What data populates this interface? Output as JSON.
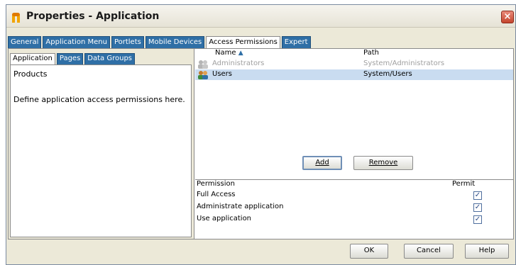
{
  "window": {
    "title": "Properties - Application",
    "close": "×"
  },
  "tabs": [
    {
      "label": "General",
      "active": false
    },
    {
      "label": "Application Menu",
      "active": false
    },
    {
      "label": "Portlets",
      "active": false
    },
    {
      "label": "Mobile Devices",
      "active": false
    },
    {
      "label": "Access Permissions",
      "active": true
    },
    {
      "label": "Expert",
      "active": false
    }
  ],
  "left": {
    "subtabs": [
      {
        "label": "Application",
        "active": true
      },
      {
        "label": "Pages",
        "active": false
      },
      {
        "label": "Data Groups",
        "active": false
      }
    ],
    "products_label": "Products",
    "help_text": "Define application access permissions here."
  },
  "users_table": {
    "columns": {
      "name": "Name",
      "sort_indicator": "▲",
      "path": "Path"
    },
    "rows": [
      {
        "name": "Administrators",
        "path": "System/Administrators",
        "icon": "user-group-icon",
        "state": "disabled"
      },
      {
        "name": "Users",
        "path": "System/Users",
        "icon": "user-group-icon",
        "state": "selected"
      }
    ]
  },
  "buttons": {
    "add": "Add",
    "remove": "Remove",
    "ok": "OK",
    "cancel": "Cancel",
    "help": "Help"
  },
  "permissions": {
    "columns": {
      "permission": "Permission",
      "permit": "Permit"
    },
    "rows": [
      {
        "label": "Full Access",
        "checked": true
      },
      {
        "label": "Administrate application",
        "checked": true
      },
      {
        "label": "Use application",
        "checked": true
      }
    ]
  },
  "colors": {
    "tab_blue": "#2f6fa6",
    "selection": "#c9dcf0",
    "dialog_bg": "#ece9d8"
  }
}
